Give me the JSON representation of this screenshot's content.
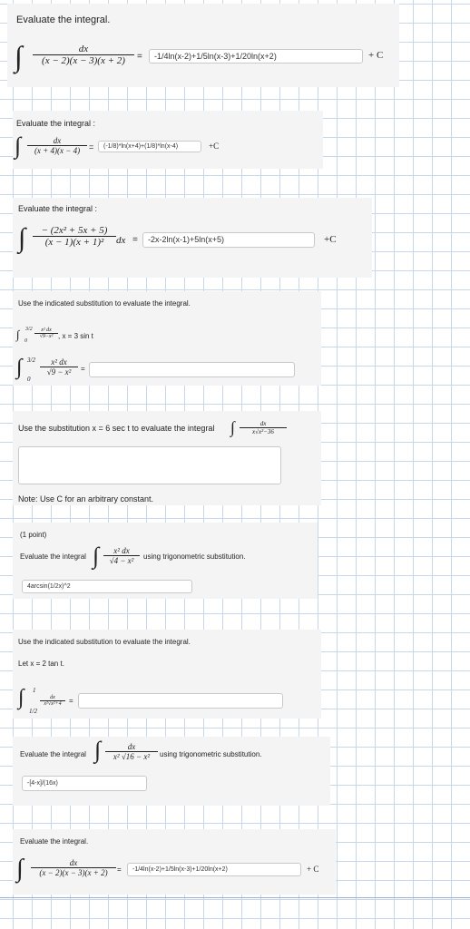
{
  "p1": {
    "instruction": "Evaluate the integral.",
    "num": "dx",
    "den": "(x − 2)(x − 3)(x + 2)",
    "eq": "=",
    "answer": "-1/4ln(x-2)+1/5ln(x-3)+1/20ln(x+2)",
    "plus_c": "+ C"
  },
  "p2": {
    "instruction": "Evaluate the integral :",
    "num": "dx",
    "den": "(x + 4)(x − 4)",
    "eq": "=",
    "answer": "(-1/8)*ln(x+4)+(1/8)*ln(x-4)",
    "plus_c": "+C"
  },
  "p3": {
    "instruction": "Evaluate the integral :",
    "num": "− (2x² + 5x + 5)",
    "den": "(x − 1)(x + 1)²",
    "dx": "dx",
    "eq": "=",
    "answer": "-2x-2ln(x-1)+5ln(x+5)",
    "plus_c": "+C"
  },
  "p4": {
    "instruction": "Use the indicated substitution to evaluate the integral.",
    "upper": "3/2",
    "lower": "0",
    "small_num": "x² dx",
    "small_den": "√9−x²",
    "sub": ", x = 3 sin t",
    "num": "x² dx",
    "den": "√9 − x²",
    "eq": "=",
    "answer": ""
  },
  "p5": {
    "instruction": "Use the substitution x = 6 sec t to evaluate the integral",
    "num": "dx",
    "den": "x√x²−36",
    "answer": "",
    "note": "Note: Use C for an arbitrary constant."
  },
  "p6": {
    "point": "(1 point)",
    "instruction": "Evaluate the integral",
    "num": "x² dx",
    "den": "√4 − x²",
    "suffix": "using trigonometric substitution.",
    "answer": "4arcsin(1/2x)^2"
  },
  "p7": {
    "instruction": "Use the indicated substitution to evaluate the integral.",
    "let": "Let x = 2 tan t.",
    "upper": "1",
    "lower": "1/2",
    "num": "dx",
    "den": "x²√x²+4",
    "eq": "=",
    "answer": ""
  },
  "p8": {
    "instruction": "Evaluate the integral",
    "num": "dx",
    "den": "x² √16 − x²",
    "suffix": "using trigonometric substitution.",
    "answer": "-[4-x]/(16x)"
  },
  "p9": {
    "instruction": "Evaluate the integral.",
    "num": "dx",
    "den": "(x − 2)(x − 3)(x + 2)",
    "eq": "=",
    "answer": "-1/4ln(x-2)+1/5ln(x-3)+1/20ln(x+2)",
    "plus_c": "+ C"
  }
}
